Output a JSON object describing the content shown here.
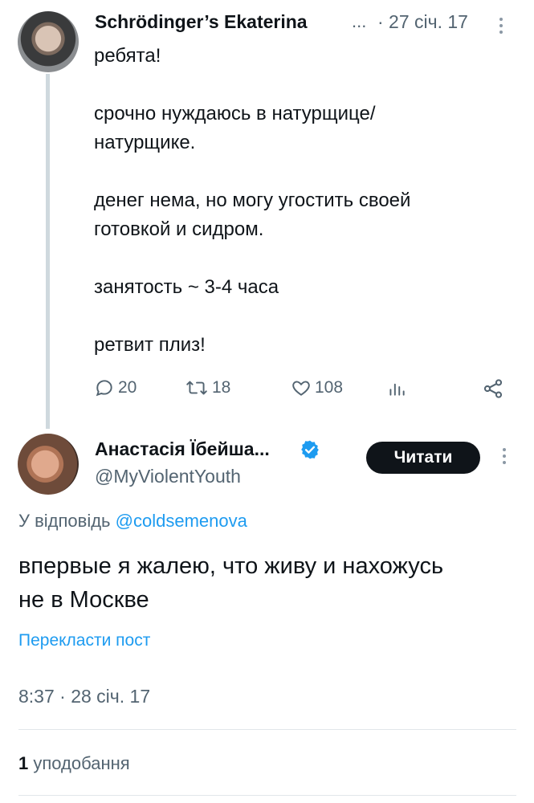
{
  "tweet1": {
    "author_name": "Schrödinger’s Ekaterina",
    "name_truncation": "...",
    "date": "· 27 січ. 17",
    "body": "ребята!\n\nсрочно нуждаюсь в натурщице/\nнатурщике.\n\nденег нема, но могу угостить своей\nготовкой и сидром.\n\nзанятость ~ 3-4 часа\n\nретвит плиз!",
    "actions": {
      "replies": "20",
      "retweets": "18",
      "likes": "108"
    }
  },
  "tweet2": {
    "author_name": "Анастасія Їбейша...",
    "handle": "@MyViolentYouth",
    "follow_label": "Читати",
    "reply_prefix": "У відповідь",
    "reply_mention": "@coldsemenova",
    "body": "впервые я жалею, что живу и нахожусь\nне в Москве",
    "translate_label": "Перекласти пост",
    "timestamp": "8:37 · 28 січ. 17",
    "likes_count": "1",
    "likes_label": "уподобання"
  },
  "colors": {
    "accent": "#1d9bf0",
    "secondary_text": "#536471",
    "primary_text": "#0f1419",
    "thread_line": "#cfd9de"
  }
}
